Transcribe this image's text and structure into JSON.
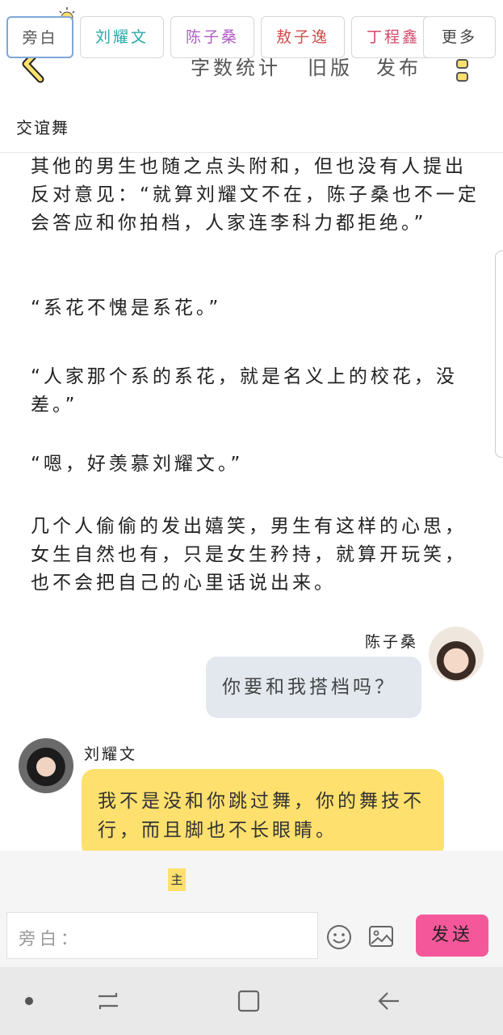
{
  "header": {
    "actions": {
      "word_count": "字数统计",
      "old_version": "旧版",
      "publish": "发布"
    }
  },
  "story": {
    "title": "交谊舞",
    "narration": [
      "其他的男生也随之点头附和，但也没有人提出反对意见：“就算刘耀文不在，陈子桑也不一定会答应和你拍档，人家连李科力都拒绝。”",
      "“系花不愧是系花。”",
      "“人家那个系的系花，就是名义上的校花，没差。”",
      "“嗯，好羡慕刘耀文。”",
      "几个人偷偷的发出嬉笑，男生有这样的心思，女生自然也有，只是女生矜持，就算开玩笑，也不会把自己的心里话说出来。"
    ]
  },
  "chat": {
    "right": {
      "speaker": "陈子桑",
      "text": "你要和我搭档吗？"
    },
    "left": {
      "speaker": "刘耀文",
      "text": "我不是没和你跳过舞，你的舞技不行，而且脚也不长眼睛。"
    }
  },
  "composer": {
    "roles": [
      "旁白",
      "刘耀文",
      "陈子桑",
      "敖子逸",
      "丁程鑫"
    ],
    "main_badge": "主",
    "more_label": "更多",
    "input_placeholder": "旁白：",
    "send_label": "发送"
  },
  "colors": {
    "accent_yellow": "#fde06d",
    "send_pink": "#f5589a",
    "bubble_gray": "#e3e8ef"
  },
  "icons": [
    "lightbulb-icon",
    "back-arrow-icon",
    "more-dots-icon",
    "emoji-icon",
    "image-icon",
    "recent-apps-icon",
    "home-icon",
    "nav-back-icon"
  ]
}
